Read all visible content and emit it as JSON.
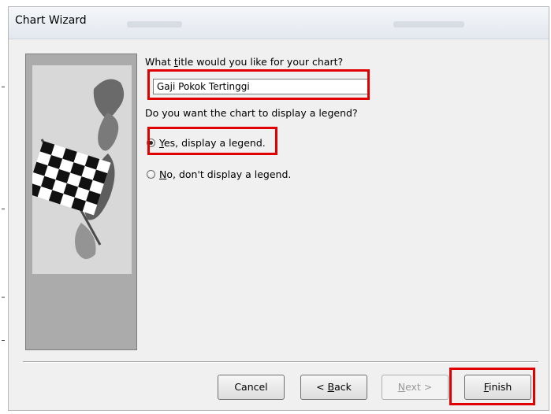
{
  "window": {
    "title": "Chart Wizard"
  },
  "wizard": {
    "title_prompt_pre": "What ",
    "title_prompt_key": "t",
    "title_prompt_post": "itle would you like for your chart?",
    "title_value": "Gaji Pokok Tertinggi",
    "legend_prompt": "Do you want the chart to display a legend?",
    "options": [
      {
        "key": "Y",
        "label_rest": "es, display a legend.",
        "checked": true
      },
      {
        "key": "N",
        "label_rest": "o, don't display a legend.",
        "checked": false
      }
    ]
  },
  "buttons": {
    "cancel": "Cancel",
    "back_prefix": "< ",
    "back_key": "B",
    "back_rest": "ack",
    "next_key": "N",
    "next_rest": "ext >",
    "finish_key": "F",
    "finish_rest": "inish"
  },
  "colors": {
    "highlight": "#e00000",
    "dialog_bg": "#f0f0f0",
    "art_panel_bg": "#ababab"
  },
  "icons": {
    "art": "checkered-flag-icon"
  }
}
